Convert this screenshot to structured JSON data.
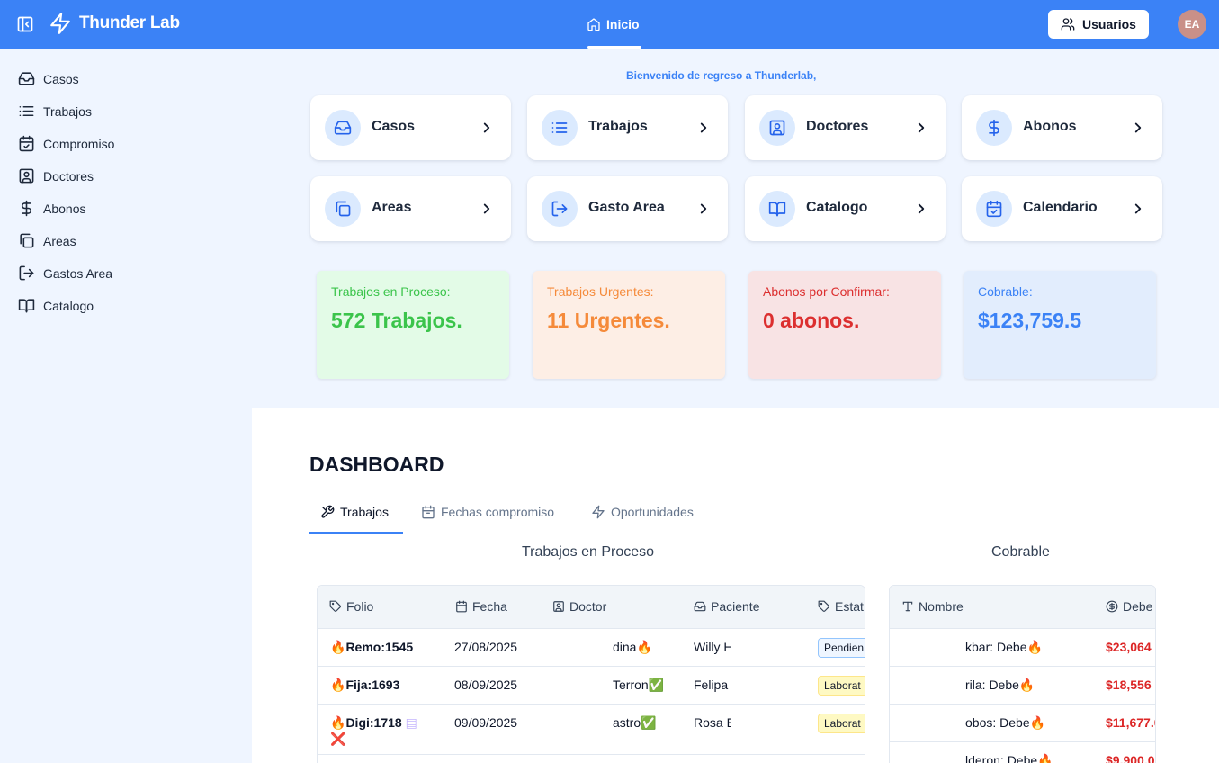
{
  "header": {
    "brand": "Thunder Lab",
    "nav_home": "Inicio",
    "users_button": "Usuarios",
    "avatar_initials": "EA",
    "accent_color": "#3b82f6"
  },
  "sidebar": {
    "items": [
      {
        "label": "Casos",
        "icon": "inbox-icon"
      },
      {
        "label": "Trabajos",
        "icon": "list-icon"
      },
      {
        "label": "Compromiso",
        "icon": "calendar-check-icon"
      },
      {
        "label": "Doctores",
        "icon": "user-square-icon"
      },
      {
        "label": "Abonos",
        "icon": "dollar-icon"
      },
      {
        "label": "Areas",
        "icon": "copy-icon"
      },
      {
        "label": "Gastos Area",
        "icon": "log-out-icon"
      },
      {
        "label": "Catalogo",
        "icon": "book-open-icon"
      }
    ]
  },
  "welcome": "Bienvenido de regreso a Thunderlab,",
  "cards": [
    {
      "label": "Casos",
      "icon": "inbox-icon"
    },
    {
      "label": "Trabajos",
      "icon": "list-icon"
    },
    {
      "label": "Doctores",
      "icon": "user-square-icon"
    },
    {
      "label": "Abonos",
      "icon": "dollar-icon"
    },
    {
      "label": "Areas",
      "icon": "copy-icon"
    },
    {
      "label": "Gasto Area",
      "icon": "log-out-icon"
    },
    {
      "label": "Catalogo",
      "icon": "book-open-icon"
    },
    {
      "label": "Calendario",
      "icon": "calendar-check-icon"
    }
  ],
  "stats": [
    {
      "label": "Trabajos en Proceso:",
      "value": "572 Trabajos.",
      "color": "#3bc44b"
    },
    {
      "label": "Trabajos Urgentes:",
      "value": "11 Urgentes.",
      "color": "#f58a3a"
    },
    {
      "label": "Abonos por Confirmar:",
      "value": "0 abonos.",
      "color": "#dc2f2f"
    },
    {
      "label": "Cobrable:",
      "value": "$123,759.5",
      "color": "#3b82f6"
    }
  ],
  "dashboard": {
    "title": "DASHBOARD",
    "tabs": [
      "Trabajos",
      "Fechas compromiso",
      "Oportunidades"
    ],
    "active_tab": "Trabajos",
    "left_section": "Trabajos en Proceso",
    "right_section": "Cobrable"
  },
  "jobs_table": {
    "columns": [
      "Folio",
      "Fecha",
      "Doctor",
      "Paciente",
      "Estat"
    ],
    "rows": [
      {
        "folio": "Remo:1545",
        "folio_extra": "",
        "fecha": "27/08/2025",
        "doctor": "dina",
        "doctor_mark": "🔥",
        "paciente": "Willy H",
        "estatus": "Pendien"
      },
      {
        "folio": "Fija:1693",
        "folio_extra": "",
        "fecha": "08/09/2025",
        "doctor": "Terron",
        "doctor_mark": "✅",
        "paciente": "Felipa",
        "estatus": "Laborat"
      },
      {
        "folio": "Digi:1718",
        "folio_extra": "❌",
        "fecha": "09/09/2025",
        "doctor": "astro",
        "doctor_mark": "✅",
        "paciente": "Rosa E",
        "estatus": "Laborat"
      }
    ]
  },
  "cobrable_table": {
    "columns": [
      "Nombre",
      "Debe"
    ],
    "rows": [
      {
        "nombre": "kbar: Debe",
        "debe": "$23,064"
      },
      {
        "nombre": "rila: Debe",
        "debe": "$18,556"
      },
      {
        "nombre": "obos: Debe",
        "debe": "$11,677.0"
      },
      {
        "nombre": "lderon: Debe",
        "debe": "$9,900.0"
      }
    ]
  }
}
